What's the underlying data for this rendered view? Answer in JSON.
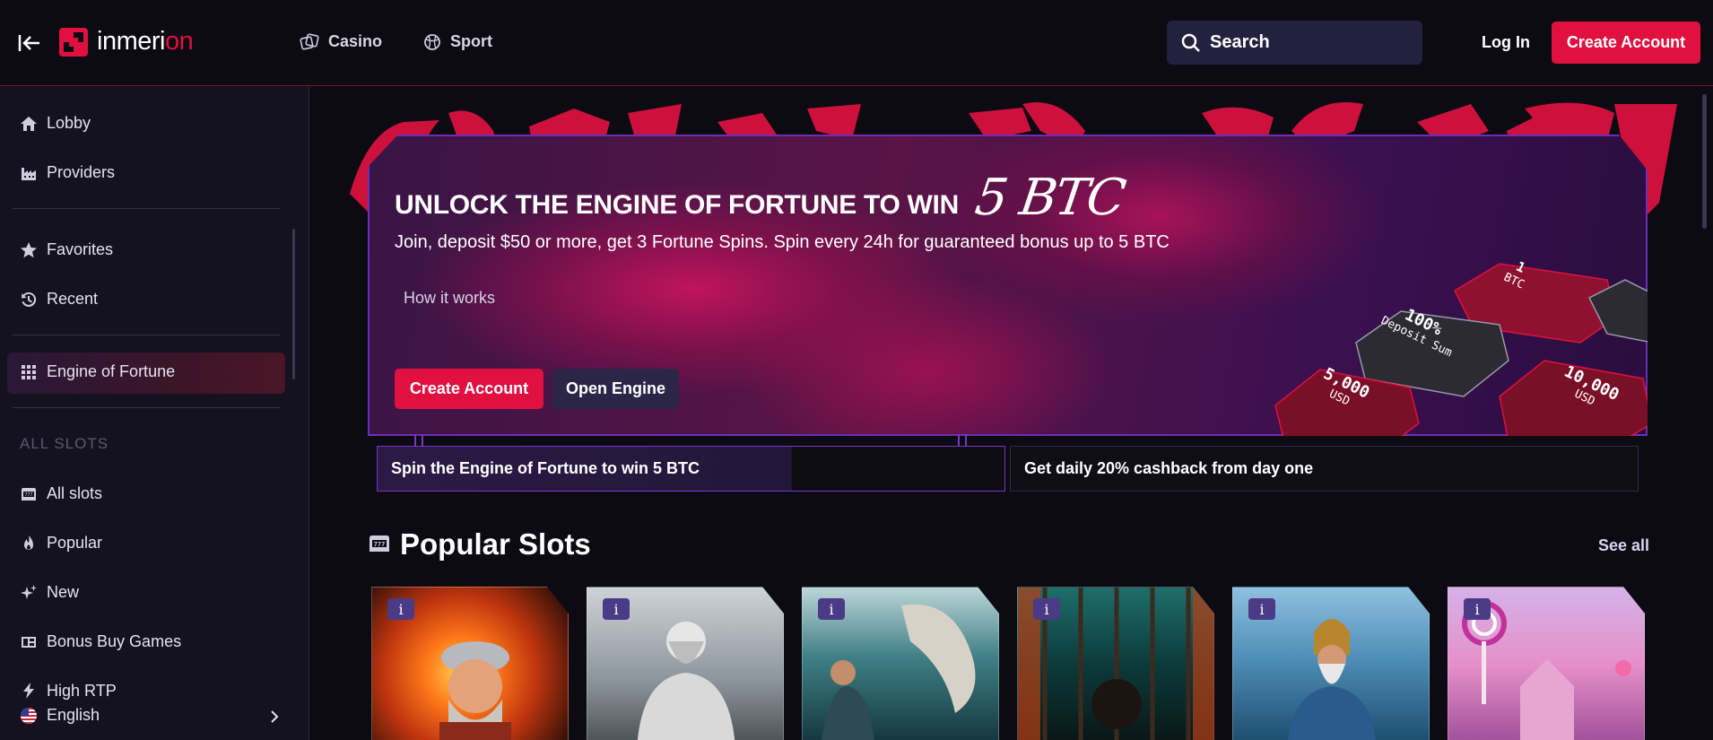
{
  "header": {
    "logo_text_main": "inmer",
    "logo_text_i": "i",
    "logo_text_accent": "on",
    "nav": [
      {
        "label": "Casino",
        "icon": "casino-chip-icon"
      },
      {
        "label": "Sport",
        "icon": "ball-icon"
      }
    ],
    "search_placeholder": "Search",
    "login_label": "Log In",
    "create_account_label": "Create Account"
  },
  "sidebar": {
    "items_top": [
      {
        "label": "Lobby",
        "icon": "home-icon"
      },
      {
        "label": "Providers",
        "icon": "factory-icon"
      }
    ],
    "items_mid": [
      {
        "label": "Favorites",
        "icon": "star-icon"
      },
      {
        "label": "Recent",
        "icon": "history-icon"
      }
    ],
    "active_item": {
      "label": "Engine of Fortune",
      "icon": "grid-icon"
    },
    "section_label": "ALL SLOTS",
    "slots_items": [
      {
        "label": "All slots",
        "icon": "slot-machine-icon"
      },
      {
        "label": "Popular",
        "icon": "flame-icon"
      },
      {
        "label": "New",
        "icon": "sparkle-icon"
      },
      {
        "label": "Bonus Buy Games",
        "icon": "bonus-icon"
      },
      {
        "label": "High RTP",
        "icon": "lightning-icon"
      }
    ],
    "language": "English"
  },
  "banner": {
    "title": "UNLOCK THE ENGINE OF FORTUNE TO WIN",
    "title_highlight": "5 BTC",
    "subtitle": "Join, deposit $50 or more, get 3 Fortune Spins. Spin every 24h for guaranteed bonus up to 5 BTC",
    "how_it_works": "How it works",
    "create_account": "Create Account",
    "open_engine": "Open Engine",
    "tiles": [
      {
        "value": "1",
        "unit": "BTC"
      },
      {
        "value": "100%",
        "unit": "Deposit Sum"
      },
      {
        "value": "5,000",
        "unit": "USD"
      },
      {
        "value": "10,000",
        "unit": "USD"
      }
    ]
  },
  "promos": [
    "Spin the Engine of Fortune to win 5 BTC",
    "Get daily 20% cashback from day one"
  ],
  "popular": {
    "title": "Popular Slots",
    "see_all": "See all",
    "info_glyph": "i",
    "cards": [
      {
        "theme": "fire-miner"
      },
      {
        "theme": "zeus-statue"
      },
      {
        "theme": "fisherman"
      },
      {
        "theme": "prison"
      },
      {
        "theme": "warrior-coast"
      },
      {
        "theme": "candy-land"
      }
    ]
  },
  "colors": {
    "brand_red": "#e0103f",
    "search_bg": "#24213f",
    "purple_accent": "#7a35c8"
  }
}
